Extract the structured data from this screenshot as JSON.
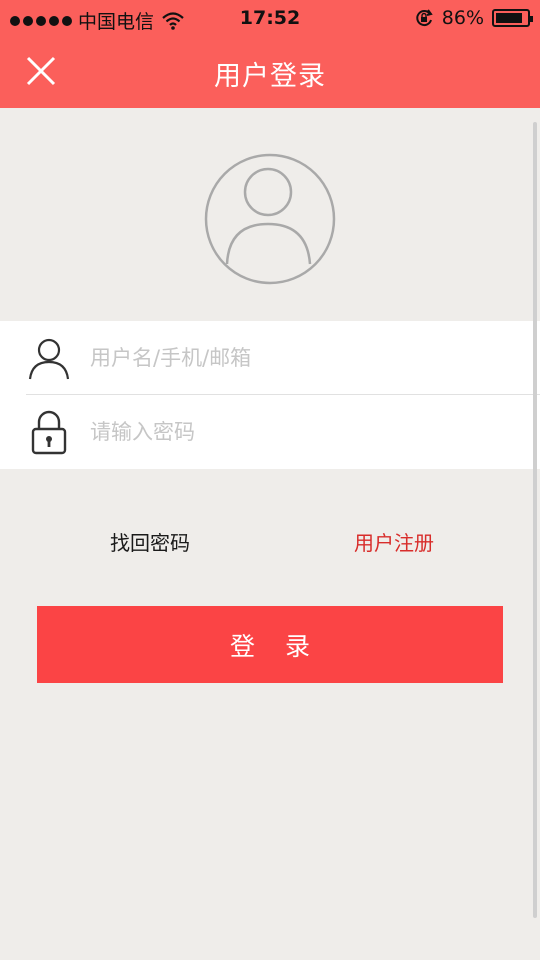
{
  "status_bar": {
    "carrier": "中国电信",
    "time": "17:52",
    "battery_percent": "86%",
    "battery_level": 0.86
  },
  "header": {
    "title": "用户登录",
    "background": "#fb5f5b"
  },
  "form": {
    "username_placeholder": "用户名/手机/邮箱",
    "password_placeholder": "请输入密码"
  },
  "links": {
    "forgot_password": "找回密码",
    "register": "用户注册"
  },
  "login_button": {
    "label": "登录",
    "color": "#fb4445"
  },
  "icons": {
    "close": "close-icon",
    "avatar": "user-avatar-icon",
    "user": "user-icon",
    "lock": "lock-icon"
  }
}
